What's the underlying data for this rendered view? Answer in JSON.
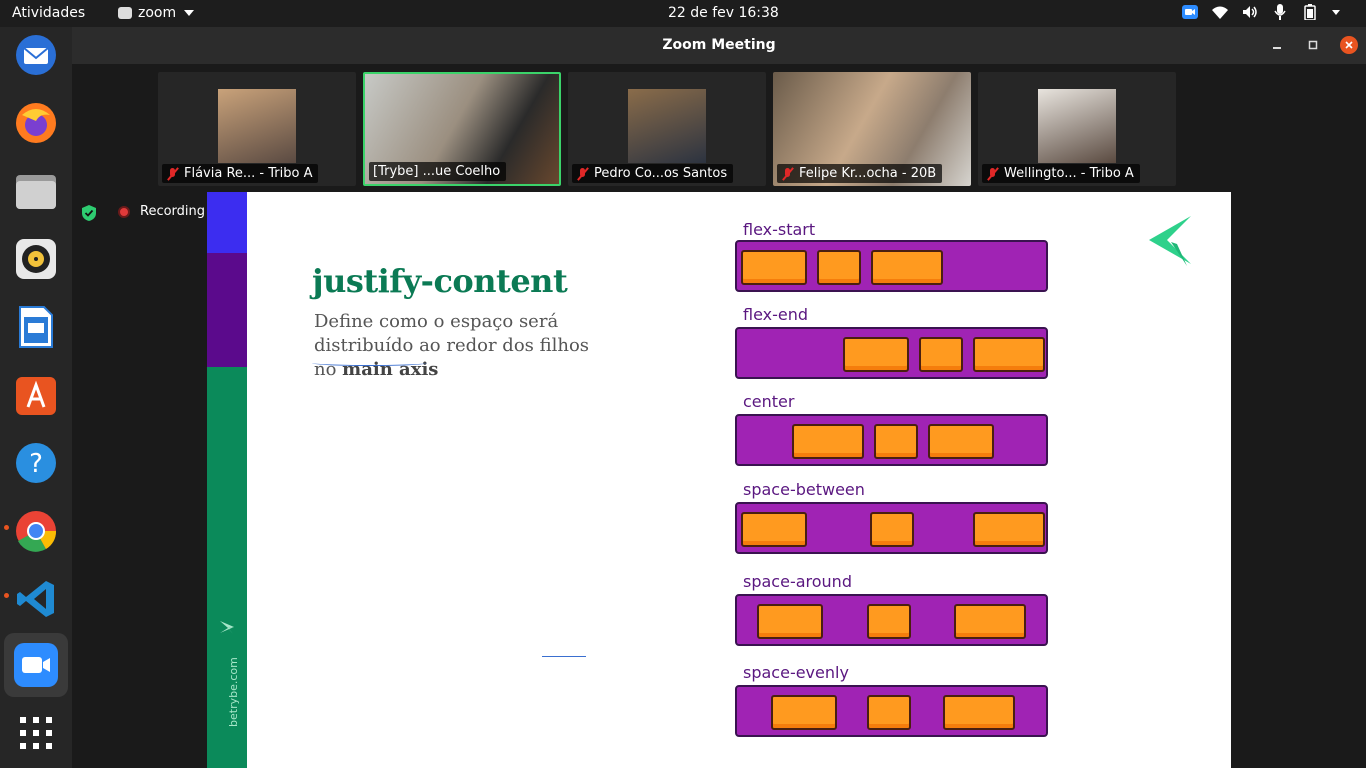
{
  "topbar": {
    "activities": "Atividades",
    "app_name": "zoom",
    "clock": "22 de fev  16:38",
    "tray_icons": [
      "zoom-tray-icon",
      "wifi-icon",
      "volume-icon",
      "microphone-icon",
      "battery-icon"
    ]
  },
  "dock": {
    "apps": [
      {
        "name": "thunderbird-icon",
        "color": "#2a6fd6"
      },
      {
        "name": "firefox-icon",
        "color": "#ff7b1f"
      },
      {
        "name": "files-icon",
        "color": "#bdbdbd"
      },
      {
        "name": "rhythmbox-icon",
        "color": "#f2c23a"
      },
      {
        "name": "libreoffice-writer-icon",
        "color": "#2a7bd6"
      },
      {
        "name": "ubuntu-software-icon",
        "color": "#e95420"
      },
      {
        "name": "help-icon",
        "color": "#2a8fe0"
      },
      {
        "name": "chrome-icon",
        "color": "#ea4335"
      },
      {
        "name": "vscode-icon",
        "color": "#1f8ad2"
      },
      {
        "name": "zoom-icon",
        "color": "#2d8cff"
      },
      {
        "name": "show-apps-icon",
        "color": "#ffffff"
      }
    ]
  },
  "window": {
    "title": "Zoom Meeting",
    "controls": [
      "minimize",
      "maximize",
      "close"
    ]
  },
  "participants": [
    {
      "name": "Flávia Re... - Tribo A",
      "muted": true,
      "active": false
    },
    {
      "name": "[Trybe] ...ue Coelho",
      "muted": false,
      "active": true
    },
    {
      "name": "Pedro Co...os Santos",
      "muted": true,
      "active": false
    },
    {
      "name": "Felipe Kr...ocha - 20B",
      "muted": true,
      "active": false
    },
    {
      "name": "Wellingto... - Tribo A",
      "muted": true,
      "active": false
    }
  ],
  "status": {
    "recording": "Recording"
  },
  "slide": {
    "site": "betrybe.com",
    "title": "justify-content",
    "desc_line1": "Define como o espaço será",
    "desc_line2": "distribuído ao redor dos filhos",
    "desc_line3_prefix": "no ",
    "desc_line3_bold": "main axis",
    "demos": [
      {
        "label": "flex-start"
      },
      {
        "label": "flex-end"
      },
      {
        "label": "center"
      },
      {
        "label": "space-between"
      },
      {
        "label": "space-around"
      },
      {
        "label": "space-evenly"
      }
    ],
    "colors": {
      "green": "#0b8a5a",
      "purple": "#a023b4",
      "orange": "#ff9a1f",
      "blue": "#3c2df0"
    }
  }
}
